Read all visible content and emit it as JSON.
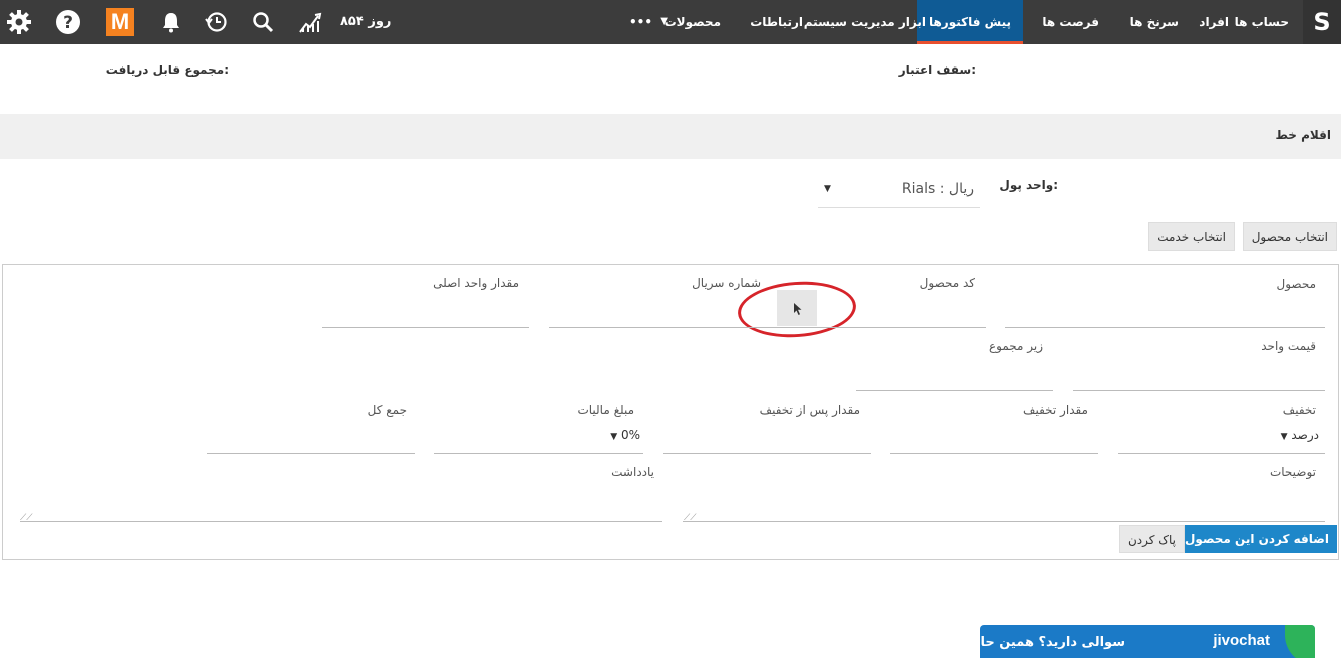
{
  "nav": {
    "logo": "S",
    "items": [
      "حساب ها",
      "افراد",
      "سرنخ ها",
      "فرصت ها",
      "پیش فاکتورها",
      "ابزار مدیریت سیستم",
      "ارتباطات",
      "محصولات",
      "•••"
    ],
    "days_left": "۸۵۴ روز",
    "m_badge": "M",
    "icons": [
      "gear-icon",
      "help-icon",
      "bell-icon",
      "history-icon",
      "search-icon",
      "chart-icon"
    ],
    "accent": "#0f5b95",
    "accent_border": "#e8502e"
  },
  "summary": {
    "credit_limit": "سقف اعتبار:",
    "total_receivable": "مجموع قابل دریافت:"
  },
  "section": {
    "title": "اقلام خط"
  },
  "currency": {
    "label": "واحد پول:",
    "value": "Rials : ریال"
  },
  "buttons": {
    "select_product": "انتخاب محصول",
    "select_service": "انتخاب خدمت",
    "add_product": "اضافه کردن این محصول",
    "clear": "پاک کردن"
  },
  "fields": {
    "product": "محصول",
    "product_code": "کد محصول",
    "serial_number": "شماره سریال",
    "base_unit_qty": "مقدار واحد اصلی",
    "unit_price": "قیمت واحد",
    "subtotal": "زیر مجموع",
    "discount": "تخفیف",
    "discount_type": "درصد",
    "discount_amount": "مقدار تخفیف",
    "after_discount": "مقدار پس از تخفیف",
    "tax_amount": "مبلغ مالیات",
    "tax_percent": "0%",
    "grand_total": "جمع کل",
    "description": "توضیحات",
    "note": "یادداشت"
  },
  "chat": {
    "message": "سوالی دارید؟ همین حالا بپرسید",
    "brand": "jivochat"
  }
}
